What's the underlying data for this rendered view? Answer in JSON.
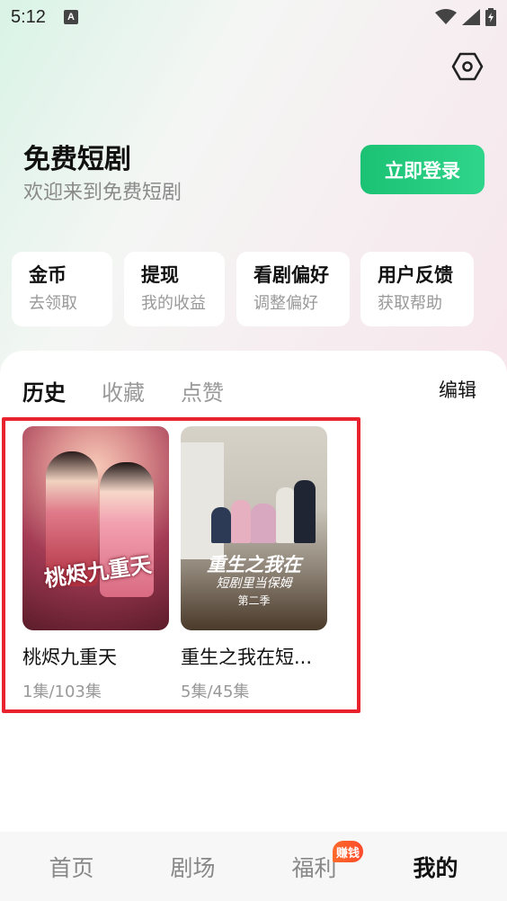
{
  "status_bar": {
    "time": "5:12",
    "a_badge": "A"
  },
  "header": {
    "title": "免费短剧",
    "subtitle": "欢迎来到免费短剧",
    "login_label": "立即登录"
  },
  "quick_actions": [
    {
      "title": "金币",
      "sub": "去领取"
    },
    {
      "title": "提现",
      "sub": "我的收益"
    },
    {
      "title": "看剧偏好",
      "sub": "调整偏好"
    },
    {
      "title": "用户反馈",
      "sub": "获取帮助"
    }
  ],
  "tabs": [
    {
      "label": "历史",
      "active": true
    },
    {
      "label": "收藏",
      "active": false
    },
    {
      "label": "点赞",
      "active": false
    }
  ],
  "edit_label": "编辑",
  "history": [
    {
      "title": "桃烬九重天",
      "episodes": "1集/103集",
      "poster_text": "桃烬九重天"
    },
    {
      "title": "重生之我在短...",
      "episodes": "5集/45集",
      "poster_text_1": "重生之我在",
      "poster_text_2": "短剧里当保姆",
      "poster_text_3": "第二季"
    }
  ],
  "bottom_nav": [
    {
      "label": "首页",
      "active": false
    },
    {
      "label": "剧场",
      "active": false
    },
    {
      "label": "福利",
      "active": false
    },
    {
      "label": "我的",
      "active": true
    }
  ],
  "earn_badge": "赚钱",
  "colors": {
    "accent_green": "#1bc274",
    "highlight_red": "#e8232e",
    "badge_orange": "#ff5a2a"
  }
}
